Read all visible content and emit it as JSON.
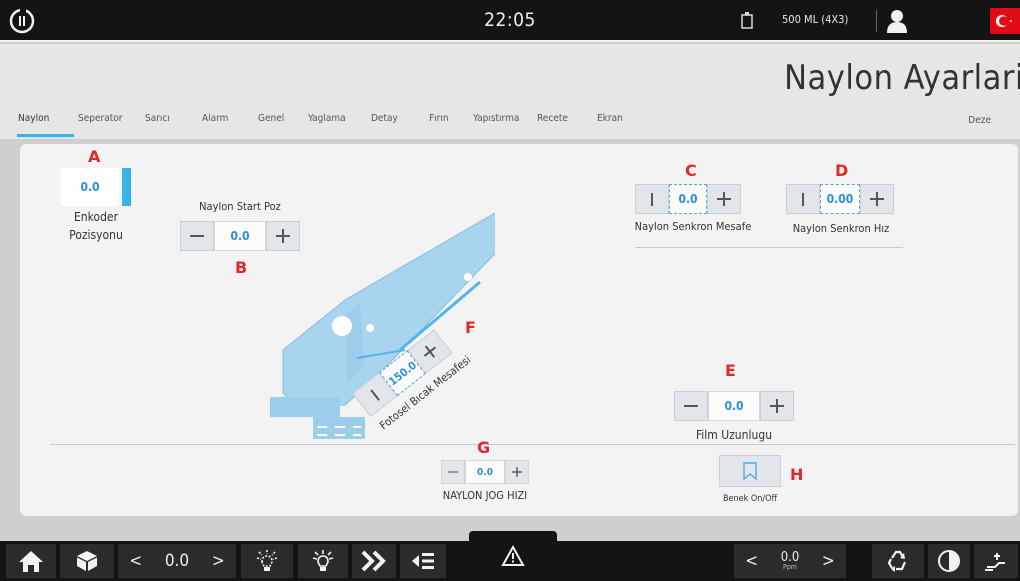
{
  "topbar": {
    "time": "22:05",
    "batch": "500 ML  (4X3)"
  },
  "header": {
    "title": "Naylon Ayarlari"
  },
  "tabs": [
    {
      "label": "Naylon"
    },
    {
      "label": "Seperator"
    },
    {
      "label": "Sarıcı"
    },
    {
      "label": "Alarm"
    },
    {
      "label": "Genel"
    },
    {
      "label": "Yaglama"
    },
    {
      "label": "Detay"
    },
    {
      "label": "Fırın"
    },
    {
      "label": "Yapıstırma"
    },
    {
      "label": "Recete"
    },
    {
      "label": "Ekran"
    }
  ],
  "tab_right": "Deze",
  "markers": {
    "a": "A",
    "b": "B",
    "c": "C",
    "d": "D",
    "e": "E",
    "f": "F",
    "g": "G",
    "h": "H"
  },
  "encoder": {
    "value": "0.0",
    "label_line1": "Enkoder",
    "label_line2": "Pozisyonu"
  },
  "start_pos": {
    "label": "Naylon Start Poz",
    "value": "0.0"
  },
  "sync_distance": {
    "label": "Naylon Senkron Mesafe",
    "value": "0.0"
  },
  "sync_speed": {
    "label": "Naylon Senkron Hız",
    "value": "0.00"
  },
  "photo_knife": {
    "label": "Fotosel Bıcak Mesafesi",
    "value": "150.0"
  },
  "film_length": {
    "label": "Film Uzunlugu",
    "value": "0.0"
  },
  "jog_speed": {
    "label": "NAYLON JOG HIZI",
    "value": "0.0"
  },
  "spot": {
    "label": "Benek On/Off"
  },
  "bottombar": {
    "left_value": "0.0",
    "right_value": "0.0",
    "right_unit": "Ppm",
    "less": "<",
    "greater": ">"
  },
  "colors": {
    "accent": "#36b3ea",
    "marker": "#e02a2a",
    "value": "#2d8fd5",
    "topbar": "#141414",
    "flag": "#e30a17"
  },
  "icons": [
    "power-icon",
    "bottle-icon",
    "user-icon",
    "flag-icon",
    "home-icon",
    "cube-icon",
    "light-off-icon",
    "light-on-icon",
    "fast-forward-icon",
    "eject-list-icon",
    "warning-icon",
    "recycle-icon",
    "contrast-icon",
    "hand-power-icon",
    "bookmark-icon"
  ]
}
